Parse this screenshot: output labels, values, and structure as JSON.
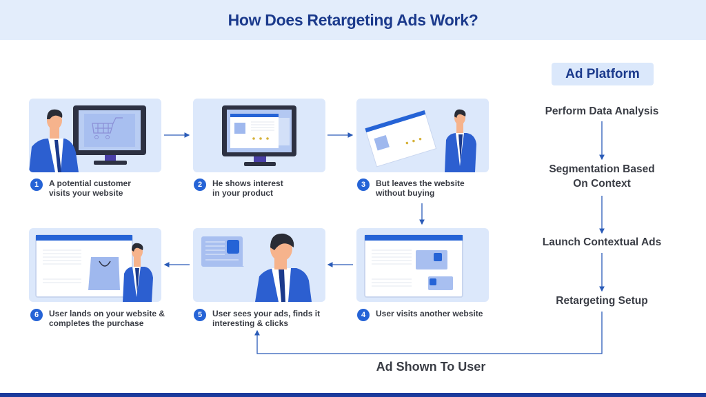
{
  "title": "How Does Retargeting Ads Work?",
  "steps": [
    {
      "number": "1",
      "text": "A potential customer\nvisits your website",
      "illustration": "man-at-monitor-shopping-cart"
    },
    {
      "number": "2",
      "text": "He shows interest\nin your product",
      "illustration": "monitor-product-page"
    },
    {
      "number": "3",
      "text": "But leaves the website\nwithout buying",
      "illustration": "man-leaving-website"
    },
    {
      "number": "4",
      "text": "User visits another website",
      "illustration": "website-with-ads"
    },
    {
      "number": "5",
      "text": "User sees your ads, finds it\ninteresting & clicks",
      "illustration": "man-seeing-ad"
    },
    {
      "number": "6",
      "text": "User lands on your website &\ncompletes the purchase",
      "illustration": "man-shopping-bag-website"
    }
  ],
  "ad_platform": {
    "label": "Ad Platform",
    "steps": [
      "Perform Data Analysis",
      "Segmentation Based\nOn Context",
      "Launch Contextual Ads",
      "Retargeting Setup"
    ]
  },
  "loop_label": "Ad Shown To User",
  "colors": {
    "accent": "#2563d6",
    "title": "#1b3a8c",
    "card_bg": "#dce8fb",
    "header_bg": "#e3edfb",
    "text": "#3a3d45",
    "arrow": "#2a5bb8"
  }
}
